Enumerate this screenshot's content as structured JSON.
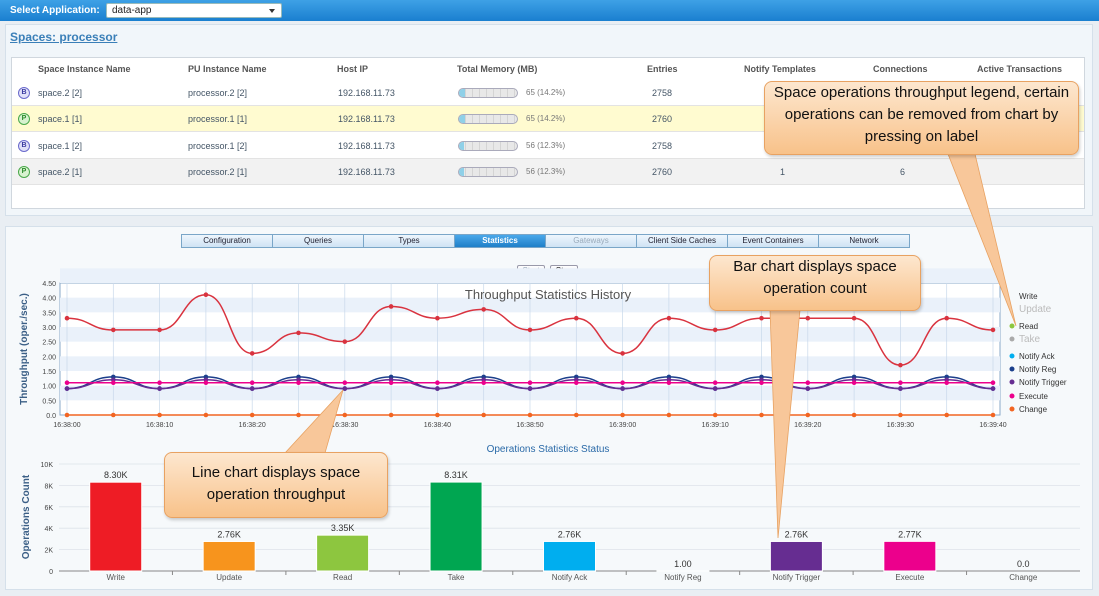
{
  "topbar": {
    "label": "Select Application:",
    "app_value": "data-app"
  },
  "spaces": {
    "title": "Spaces: processor",
    "columns": [
      "Space Instance Name",
      "PU Instance Name",
      "Host IP",
      "Total Memory (MB)",
      "Entries",
      "Notify Templates",
      "Connections",
      "Active Transactions"
    ],
    "rows": [
      {
        "icon": "B",
        "name": "space.2 [2]",
        "pu": "processor.2 [2]",
        "host": "192.168.11.73",
        "mem": "65 (14.2%)",
        "mem_pct": 0.142,
        "entries": "2758",
        "notify": "",
        "conn": "",
        "trans": ""
      },
      {
        "icon": "P",
        "name": "space.1 [1]",
        "pu": "processor.1 [1]",
        "host": "192.168.11.73",
        "mem": "65 (14.2%)",
        "mem_pct": 0.142,
        "entries": "2760",
        "notify": "",
        "conn": "",
        "trans": ""
      },
      {
        "icon": "B",
        "name": "space.1 [2]",
        "pu": "processor.1 [2]",
        "host": "192.168.11.73",
        "mem": "56 (12.3%)",
        "mem_pct": 0.123,
        "entries": "2758",
        "notify": "",
        "conn": "",
        "trans": ""
      },
      {
        "icon": "P",
        "name": "space.2 [1]",
        "pu": "processor.2 [1]",
        "host": "192.168.11.73",
        "mem": "56 (12.3%)",
        "mem_pct": 0.123,
        "entries": "2760",
        "notify": "1",
        "conn": "6",
        "trans": ""
      }
    ]
  },
  "tabs": [
    "Configuration",
    "Queries",
    "Types",
    "Statistics",
    "Gateways",
    "Client Side Caches",
    "Event Containers",
    "Network"
  ],
  "controls": {
    "start": "Start",
    "stop": "Stop"
  },
  "callouts": {
    "legend": "Space operations throughput legend, certain operations can be removed from chart by pressing on label",
    "bar": "Bar chart displays space operation count",
    "line": "Line chart displays space operation throughput"
  },
  "colors": {
    "write": "#ee1c25",
    "update": "#f7941d",
    "read": "#8dc63f",
    "take": "#00a651",
    "notify_ack": "#00aeef",
    "notify_reg": "#1b3f8b",
    "notify_trigger": "#662d91",
    "execute": "#ec008c",
    "change": "#f26522"
  },
  "chart_data": [
    {
      "type": "line",
      "title": "Throughput Statistics History",
      "ylabel": "Throughput (oper./sec.)",
      "ylim": [
        0,
        4.5
      ],
      "yticks": [
        "0.0",
        "0.50",
        "1.00",
        "1.50",
        "2.00",
        "2.50",
        "3.00",
        "3.50",
        "4.00",
        "4.50"
      ],
      "xticks": [
        "16:38:00",
        "16:38:10",
        "16:38:20",
        "16:38:30",
        "16:38:40",
        "16:38:50",
        "16:39:00",
        "16:39:10",
        "16:39:20",
        "16:39:30",
        "16:39:40"
      ],
      "x": [
        "16:38:00",
        "16:38:05",
        "16:38:10",
        "16:38:15",
        "16:38:20",
        "16:38:25",
        "16:38:30",
        "16:38:35",
        "16:38:40",
        "16:38:45",
        "16:38:50",
        "16:38:55",
        "16:39:00",
        "16:39:05",
        "16:39:10",
        "16:39:15",
        "16:39:20",
        "16:39:25",
        "16:39:30",
        "16:39:35",
        "16:39:40"
      ],
      "series": [
        {
          "name": "Write",
          "color": "#d9333f",
          "values": [
            3.3,
            2.9,
            2.9,
            4.1,
            2.1,
            2.8,
            2.5,
            3.7,
            3.3,
            3.6,
            2.9,
            3.3,
            2.1,
            3.3,
            2.9,
            3.3,
            3.3,
            3.3,
            1.7,
            3.3,
            2.9
          ]
        },
        {
          "name": "Notify Reg",
          "color": "#1b3f8b",
          "values": [
            0.9,
            1.3,
            0.9,
            1.3,
            0.9,
            1.3,
            0.9,
            1.3,
            0.9,
            1.3,
            0.9,
            1.3,
            0.9,
            1.3,
            0.9,
            1.3,
            0.9,
            1.3,
            0.9,
            1.3,
            0.9
          ]
        },
        {
          "name": "Notify Trigger",
          "color": "#662d91",
          "values": [
            0.9,
            1.2,
            0.9,
            1.2,
            0.9,
            1.2,
            0.9,
            1.2,
            0.9,
            1.2,
            0.9,
            1.2,
            0.9,
            1.2,
            0.9,
            1.2,
            0.9,
            1.2,
            0.9,
            1.2,
            0.9
          ]
        },
        {
          "name": "Execute",
          "color": "#ec008c",
          "values": [
            1.1,
            1.1,
            1.1,
            1.1,
            1.1,
            1.1,
            1.1,
            1.1,
            1.1,
            1.1,
            1.1,
            1.1,
            1.1,
            1.1,
            1.1,
            1.1,
            1.1,
            1.1,
            1.1,
            1.1,
            1.1
          ]
        },
        {
          "name": "Change",
          "color": "#f26522",
          "values": [
            0,
            0,
            0,
            0,
            0,
            0,
            0,
            0,
            0,
            0,
            0,
            0,
            0,
            0,
            0,
            0,
            0,
            0,
            0,
            0,
            0
          ]
        }
      ],
      "legend": [
        {
          "name": "Write",
          "color": "",
          "enabled": true
        },
        {
          "name": "Update",
          "color": "",
          "enabled": false
        },
        {
          "name": "Read",
          "color": "#8dc63f",
          "enabled": true
        },
        {
          "name": "Take",
          "color": "#aaaaaa",
          "enabled": false
        },
        {
          "name": "Notify Ack",
          "color": "#00aeef",
          "enabled": true
        },
        {
          "name": "Notify Reg",
          "color": "#1b3f8b",
          "enabled": true
        },
        {
          "name": "Notify Trigger",
          "color": "#662d91",
          "enabled": true
        },
        {
          "name": "Execute",
          "color": "#ec008c",
          "enabled": true
        },
        {
          "name": "Change",
          "color": "#f26522",
          "enabled": true
        }
      ],
      "legend_position": "right",
      "grid": true
    },
    {
      "type": "bar",
      "title": "Operations Statistics Status",
      "ylabel": "Operations Count",
      "ylim": [
        0,
        10000
      ],
      "yticks": [
        "0",
        "2K",
        "4K",
        "6K",
        "8K",
        "10K"
      ],
      "categories": [
        "Write",
        "Update",
        "Read",
        "Take",
        "Notify Ack",
        "Notify Reg",
        "Notify Trigger",
        "Execute",
        "Change"
      ],
      "values": [
        8300,
        2760,
        3350,
        8310,
        2760,
        1,
        2760,
        2770,
        0
      ],
      "labels": [
        "8.30K",
        "2.76K",
        "3.35K",
        "8.31K",
        "2.76K",
        "1.00",
        "2.76K",
        "2.77K",
        "0.0"
      ],
      "colors": [
        "#ee1c25",
        "#f7941d",
        "#8dc63f",
        "#00a651",
        "#00aeef",
        "#1b3f8b",
        "#662d91",
        "#ec008c",
        "#f26522"
      ],
      "grid": true
    }
  ]
}
